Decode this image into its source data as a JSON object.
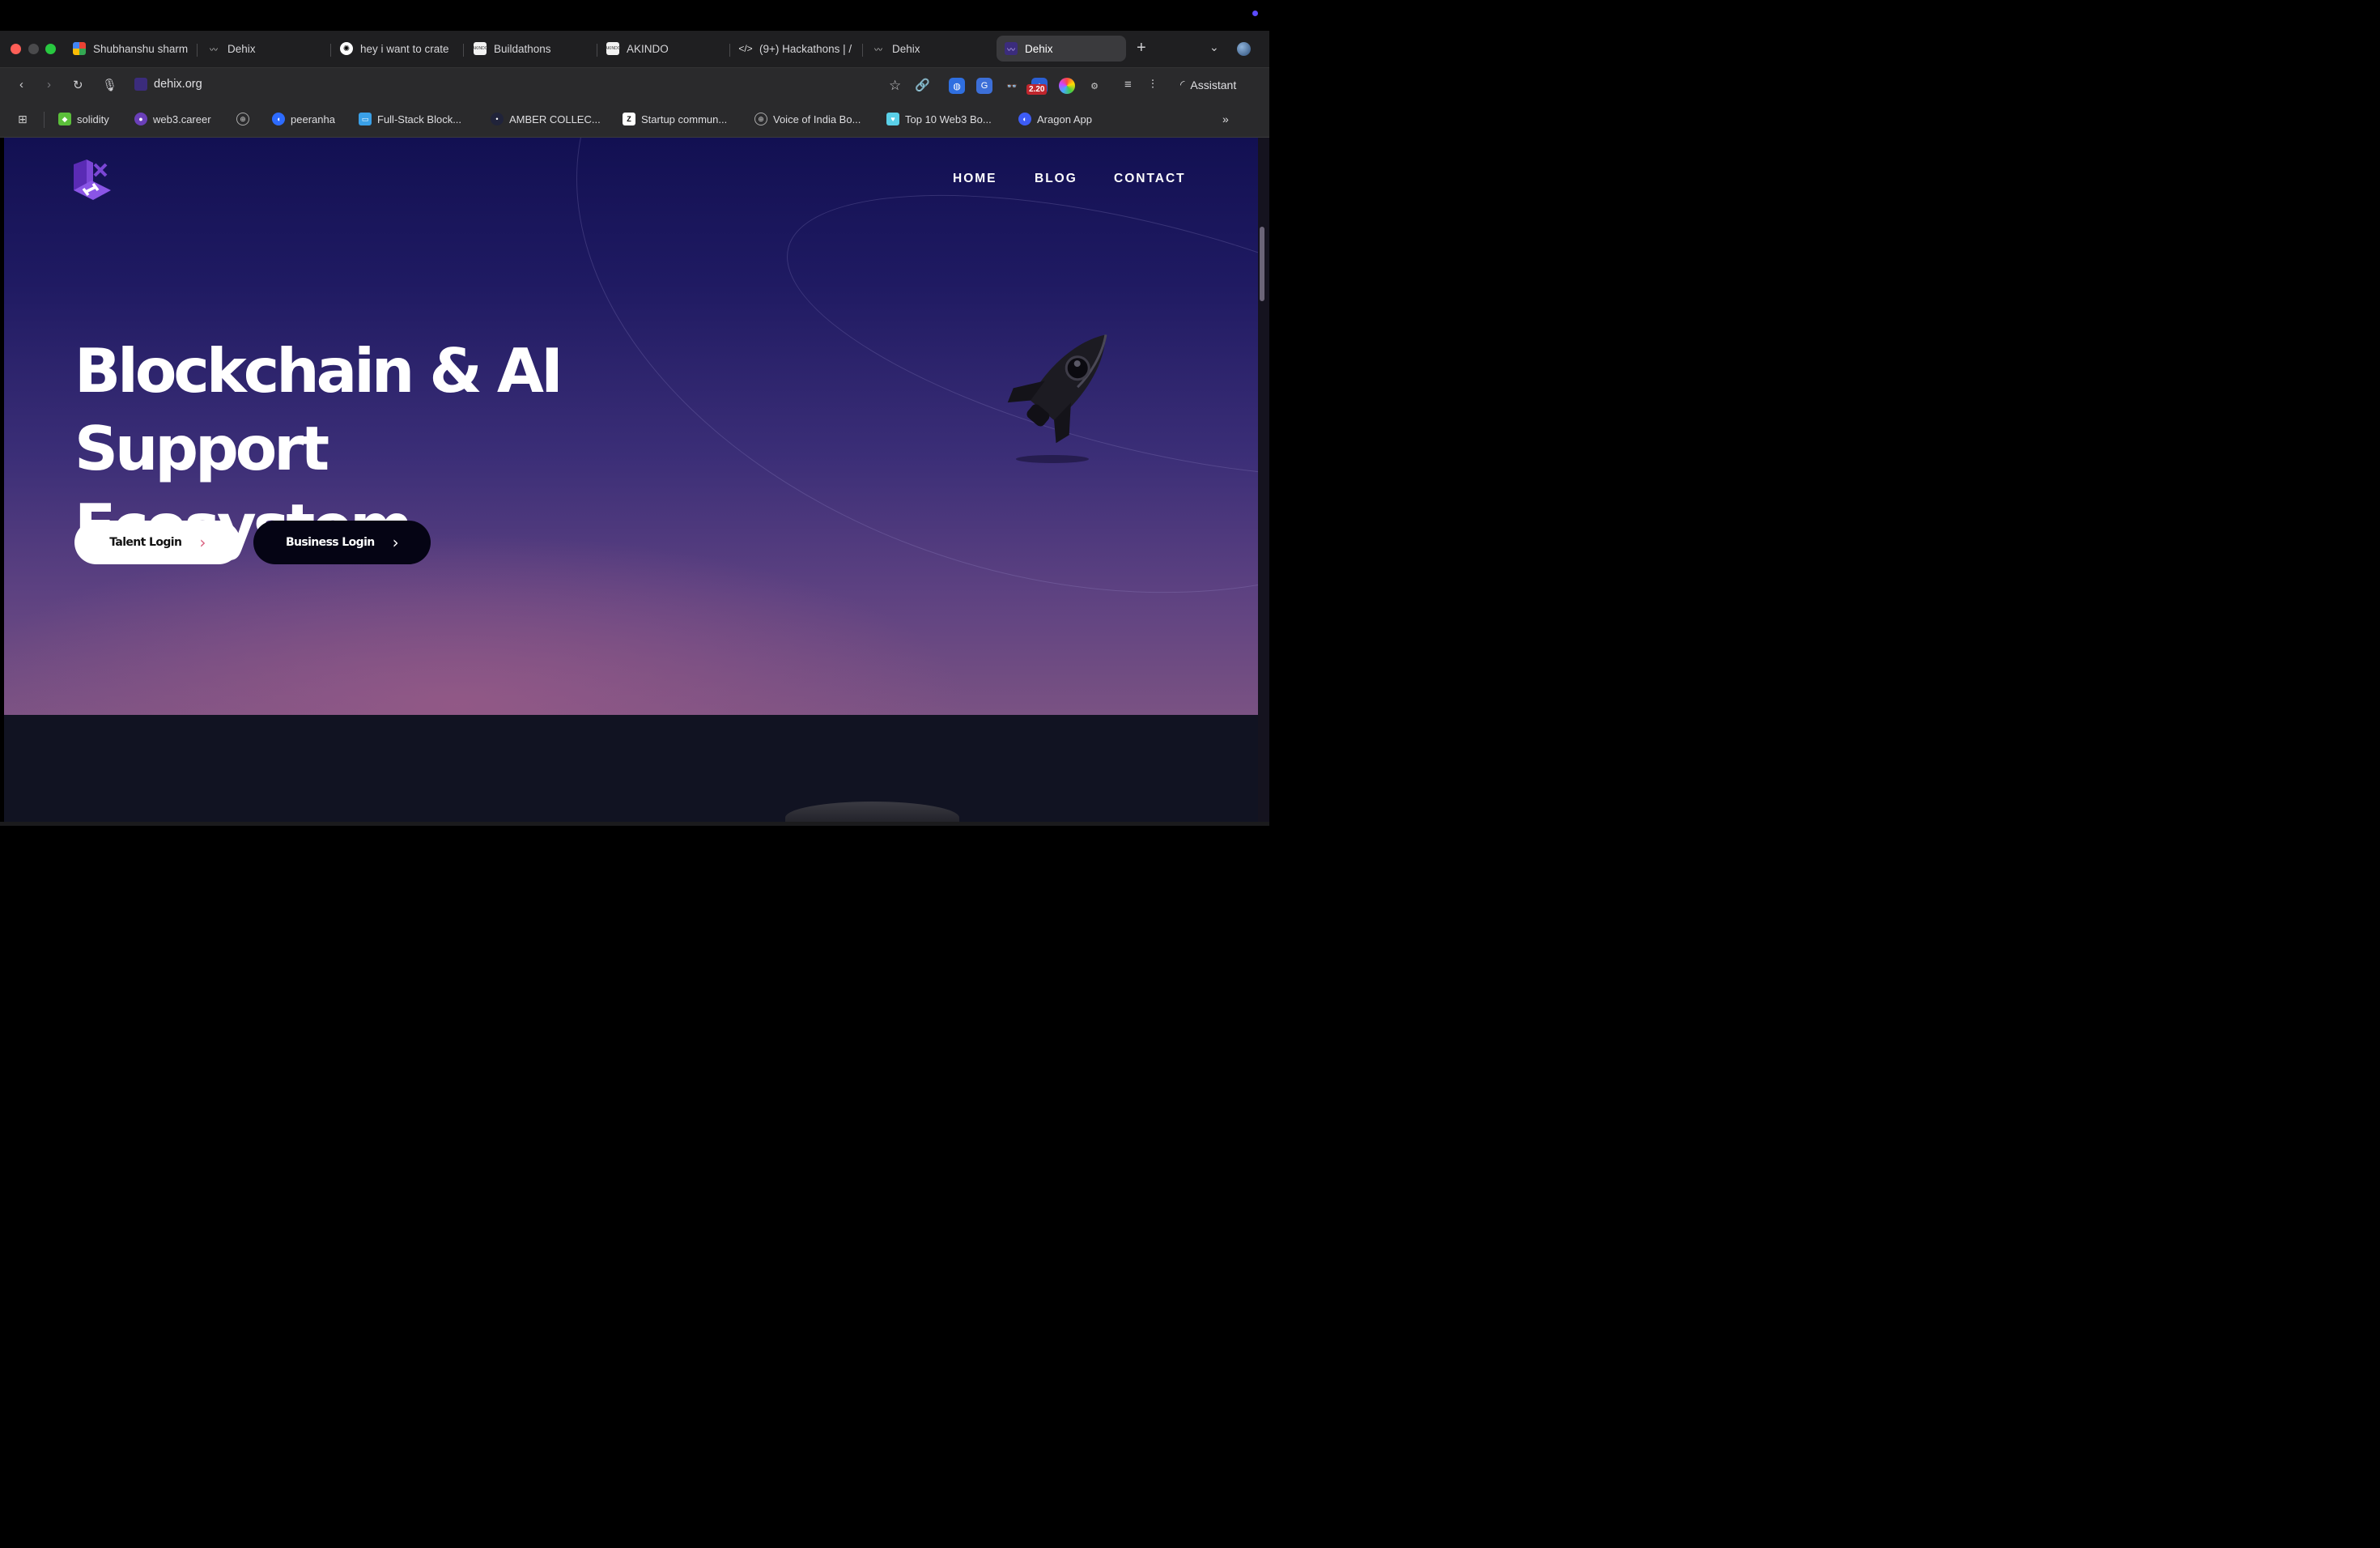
{
  "browser": {
    "tabs": [
      {
        "label": "Shubhanshu sharm",
        "favicon": "chat-color-icon"
      },
      {
        "label": "Dehix",
        "favicon": "dehix-logo-icon"
      },
      {
        "label": "hey i want to crate",
        "favicon": "openai-icon"
      },
      {
        "label": "Buildathons",
        "favicon": "akindo-icon"
      },
      {
        "label": "AKINDO",
        "favicon": "akindo-icon"
      },
      {
        "label": "(9+) Hackathons | /",
        "favicon": "code-icon"
      },
      {
        "label": "Dehix",
        "favicon": "dehix-logo-icon"
      },
      {
        "label": "Dehix",
        "favicon": "dehix-logo-icon",
        "active": true
      }
    ],
    "address": "dehix.org",
    "extension_badge": "2.20",
    "assistant_label": "Assistant",
    "bookmarks": [
      {
        "label": "solidity",
        "favicon": "solidity-icon"
      },
      {
        "label": "web3.career",
        "favicon": "crystal-ball-icon"
      },
      {
        "label": "",
        "favicon": "globe-icon"
      },
      {
        "label": "peeranha",
        "favicon": "peeranha-icon"
      },
      {
        "label": "Full-Stack Block...",
        "favicon": "bookmark-icon"
      },
      {
        "label": "AMBER COLLEC...",
        "favicon": "amber-icon"
      },
      {
        "label": "Startup commun...",
        "favicon": "z-icon"
      },
      {
        "label": "Voice of India Bo...",
        "favicon": "globe-icon"
      },
      {
        "label": "Top 10 Web3 Bo...",
        "favicon": "heart-icon"
      },
      {
        "label": "Aragon App",
        "favicon": "aragon-icon"
      }
    ]
  },
  "site": {
    "nav": {
      "home": "HOME",
      "blog": "BLOG",
      "contact": "CONTACT"
    },
    "headline_line1": "Blockchain & AI Support",
    "headline_line2": "Ecosystem",
    "talent_login": "Talent Login",
    "business_login": "Business Login"
  },
  "colors": {
    "accent_arrow": "#d9607f",
    "hero_top": "#121052",
    "hero_bottom": "#7a5283"
  }
}
